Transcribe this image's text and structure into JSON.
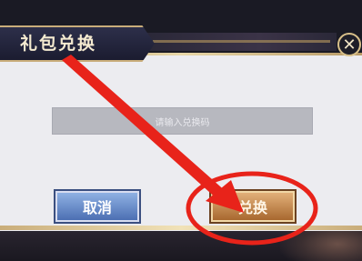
{
  "dialog": {
    "title": "礼包兑换",
    "close_glyph": "✕",
    "input": {
      "placeholder": "请输入兑换码"
    },
    "cancel_label": "取消",
    "confirm_label": "兑换"
  },
  "annotation": {
    "arrow_color": "#e8231a",
    "circle_color": "#e8231a"
  }
}
